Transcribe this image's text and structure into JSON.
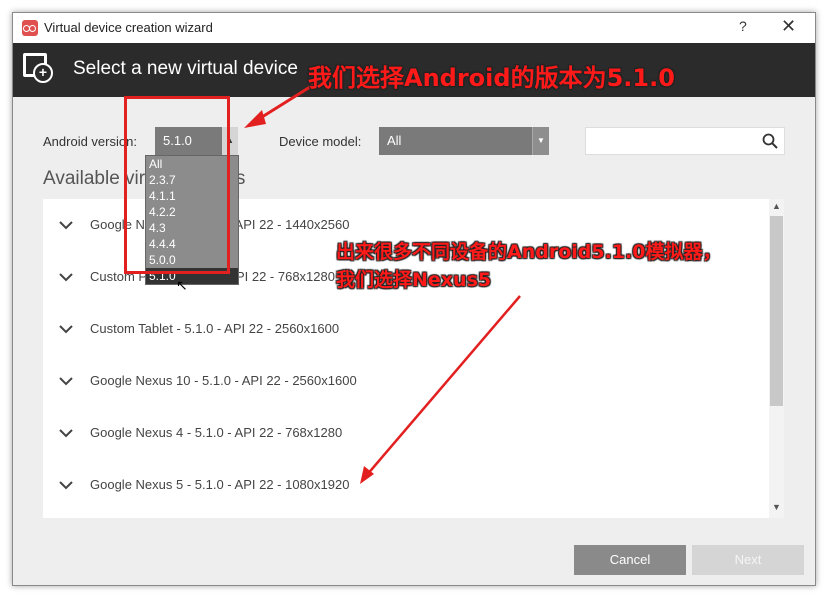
{
  "window": {
    "title": "Virtual device creation wizard",
    "help_label": "?",
    "close_label": "✕"
  },
  "header": {
    "title": "Select a new virtual device",
    "icon": "add-device-icon"
  },
  "filters": {
    "android_version_label": "Android version:",
    "android_version_value": "5.1.0",
    "device_model_label": "Device model:",
    "device_model_value": "All",
    "search_placeholder": ""
  },
  "section_title": "Available virtual devices",
  "version_options": [
    "All",
    "2.3.7",
    "4.1.1",
    "4.2.2",
    "4.3",
    "4.4.4",
    "5.0.0",
    "5.1.0"
  ],
  "devices": [
    "Google Nexus 6 - 5.1.0 - API 22 - 1440x2560",
    "Custom Phone - 5.1.0 - API 22 - 768x1280",
    "Custom Tablet - 5.1.0 - API 22 - 2560x1600",
    "Google Nexus 10 - 5.1.0 - API 22 - 2560x1600",
    "Google Nexus 4 - 5.1.0 - API 22 - 768x1280",
    "Google Nexus 5 - 5.1.0 - API 22 - 1080x1920"
  ],
  "buttons": {
    "cancel": "Cancel",
    "next": "Next"
  },
  "annotations": {
    "top": "我们选择Android的版本为5.1.0",
    "bottom_line1": "出来很多不同设备的Android5.1.0模拟器，",
    "bottom_line2": "我们选择Nexus5"
  },
  "colors": {
    "annotation": "#ff1a1a",
    "header_bg": "#2b2b2b",
    "select_bg": "#7a7a7a"
  }
}
